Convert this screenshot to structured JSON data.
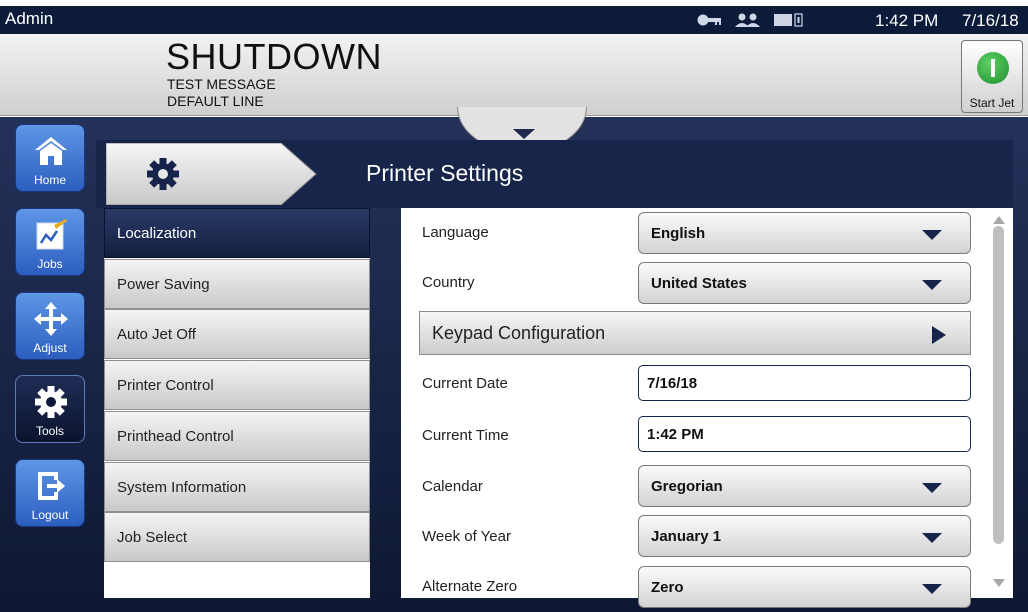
{
  "status_bar": {
    "user": "Admin",
    "time": "1:42 PM",
    "date": "7/16/18",
    "icons": [
      "key-icon",
      "users-icon",
      "battery-icon"
    ]
  },
  "header": {
    "printer_state": "SHUTDOWN",
    "message": "TEST MESSAGE",
    "line": "DEFAULT LINE",
    "start_jet_label": "Start Jet"
  },
  "nav": [
    {
      "label": "Home",
      "icon": "home-icon"
    },
    {
      "label": "Jobs",
      "icon": "jobs-icon"
    },
    {
      "label": "Adjust",
      "icon": "move-icon"
    },
    {
      "label": "Tools",
      "icon": "gear-icon",
      "active": true
    },
    {
      "label": "Logout",
      "icon": "logout-icon"
    }
  ],
  "panel": {
    "title": "Printer Settings",
    "icon": "gear-icon"
  },
  "menu": [
    {
      "label": "Localization",
      "selected": true
    },
    {
      "label": "Power Saving"
    },
    {
      "label": "Auto Jet Off"
    },
    {
      "label": "Printer Control"
    },
    {
      "label": "Printhead Control"
    },
    {
      "label": "System Information"
    },
    {
      "label": "Job Select"
    }
  ],
  "settings": {
    "language": {
      "label": "Language",
      "value": "English"
    },
    "country": {
      "label": "Country",
      "value": "United States"
    },
    "keypad": {
      "label": "Keypad Configuration"
    },
    "current_date": {
      "label": "Current Date",
      "value": "7/16/18"
    },
    "current_time": {
      "label": "Current Time",
      "value": "1:42 PM"
    },
    "calendar": {
      "label": "Calendar",
      "value": "Gregorian"
    },
    "week_of_year": {
      "label": "Week of Year",
      "value": "January 1"
    },
    "alternate_zero": {
      "label": "Alternate Zero",
      "value": "Zero"
    }
  },
  "colors": {
    "navy": "#16234a",
    "nav_blue": "#3a6fd0",
    "start_green": "#2aa83a"
  }
}
